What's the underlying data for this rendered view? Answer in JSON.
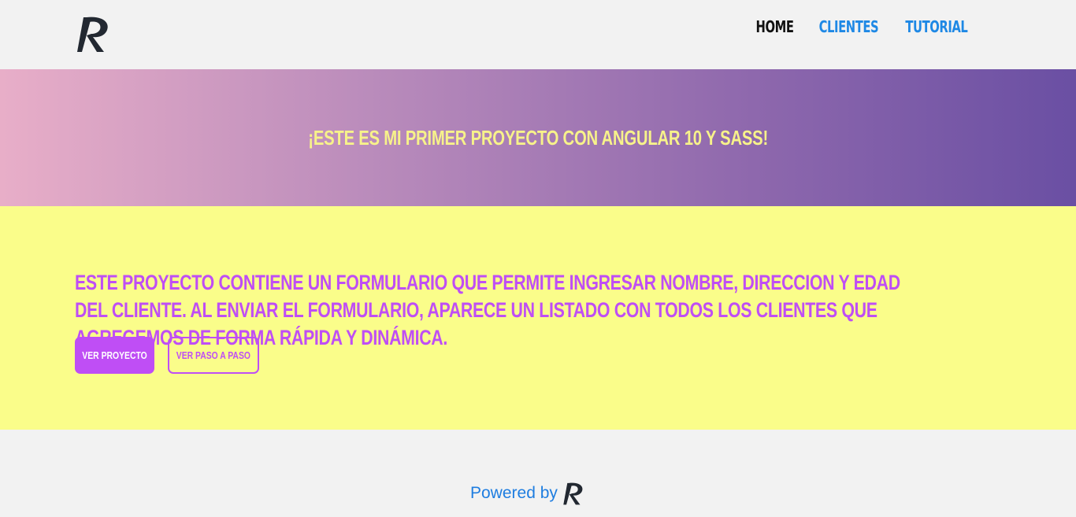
{
  "header": {
    "logo_icon": "rp-logo-icon",
    "nav": [
      {
        "label": "HOME"
      },
      {
        "label": "CLIENTES"
      },
      {
        "label": "TUTORIAL"
      }
    ]
  },
  "banner": {
    "title": "¡ESTE ES MI PRIMER PROYECTO CON ANGULAR 10 Y SASS!"
  },
  "info": {
    "description": "ESTE PROYECTO CONTIENE UN FORMULARIO QUE PERMITE INGRESAR NOMBRE, DIRECCION Y EDAD DEL CLIENTE. AL ENVIAR EL FORMULARIO, APARECE UN LISTADO CON TODOS LOS CLIENTES QUE AGREGEMOS DE FORMA RÁPIDA Y DINÁMICA.",
    "primary_button": "VER PROYECTO",
    "secondary_button": "VER PASO A PASO"
  },
  "footer": {
    "powered_text": "Powered by",
    "logo_icon": "rp-logo-icon"
  },
  "colors": {
    "accent": "#bf4ef5",
    "link": "#1e88e5",
    "banner_text": "#f7f28a",
    "info_bg": "#fafd8a",
    "gradient_start": "#e8aec8",
    "gradient_end": "#6a4fa3"
  }
}
